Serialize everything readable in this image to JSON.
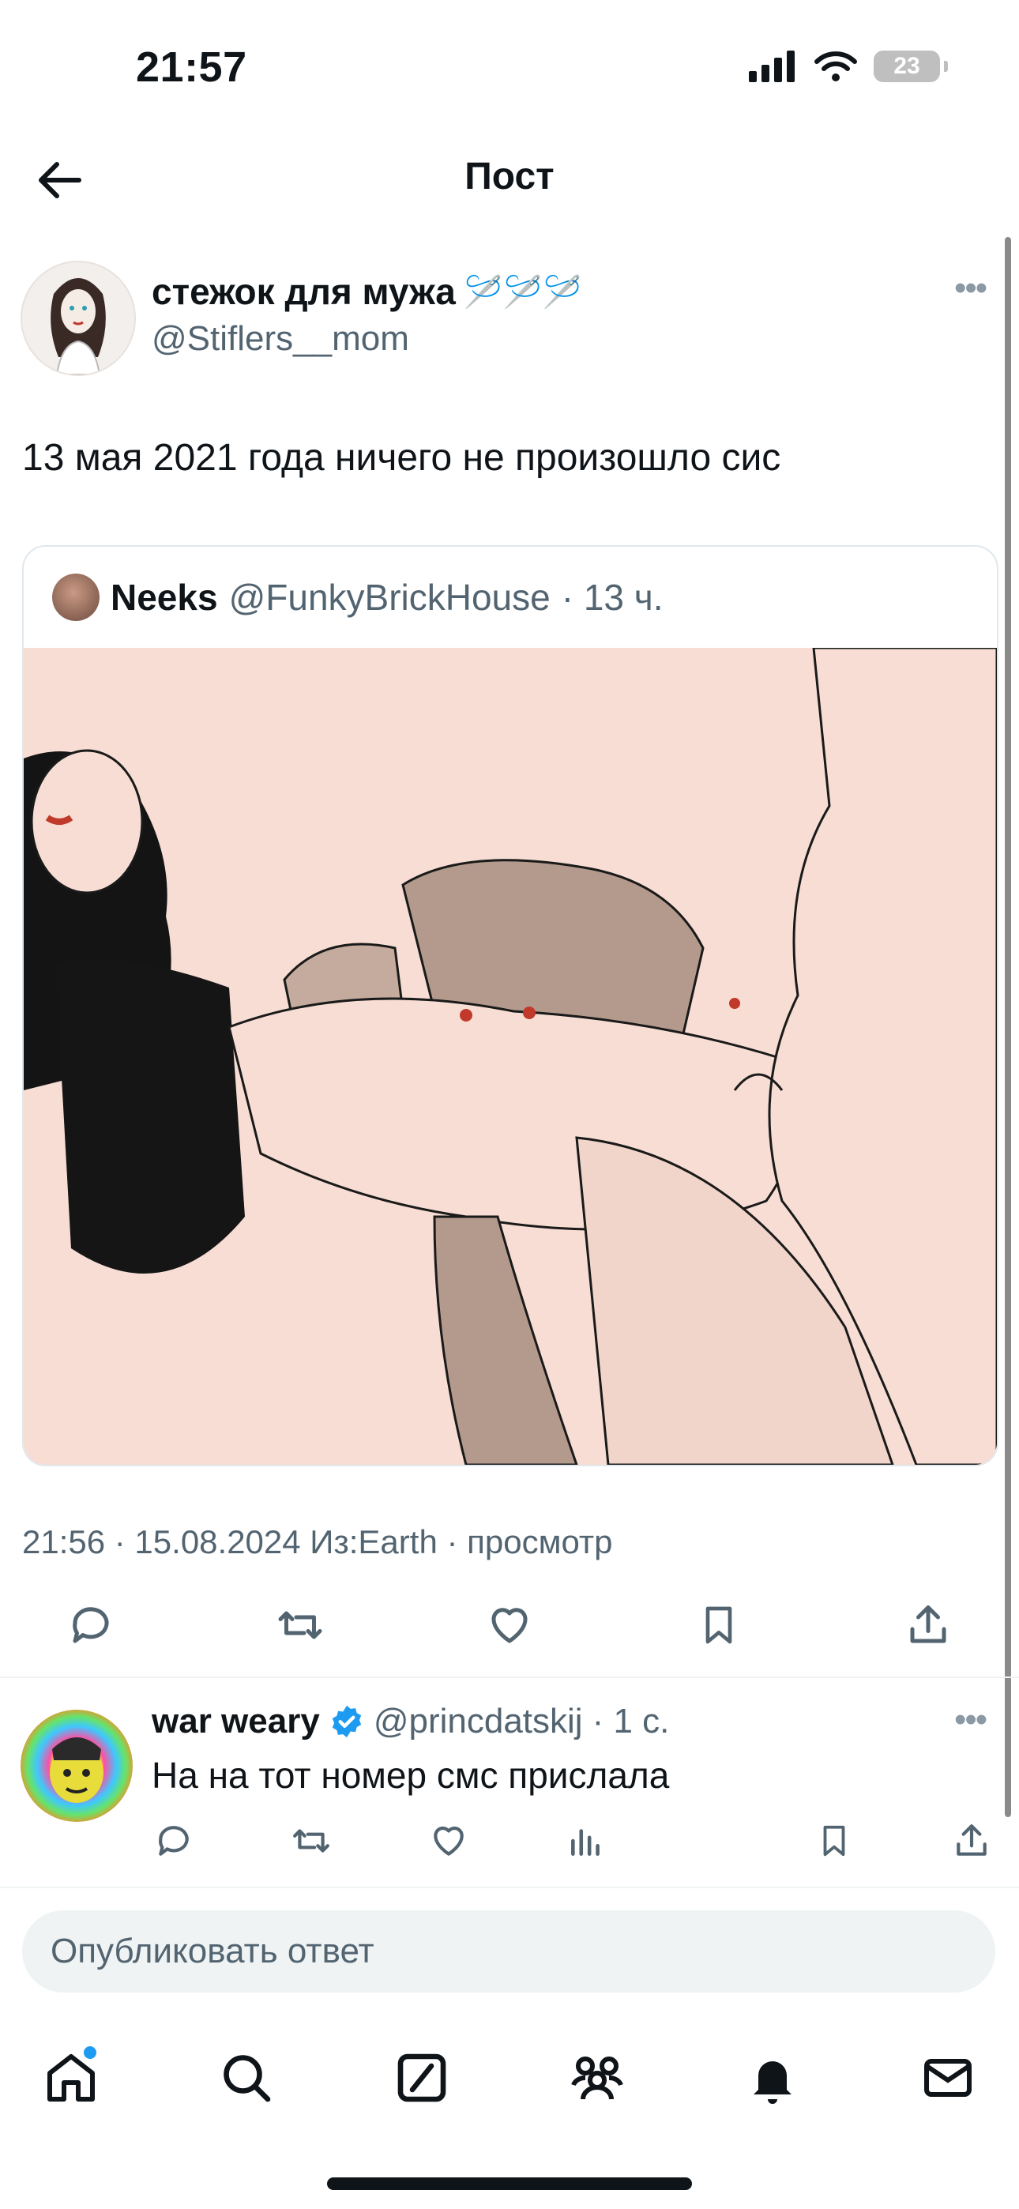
{
  "status_bar": {
    "time": "21:57",
    "battery": "23"
  },
  "header": {
    "title": "Пост"
  },
  "post": {
    "author_name": "стежок для мужа",
    "author_emoji": "🪡🪡🪡",
    "author_handle": "@Stiflers__mom",
    "text": "13 мая 2021 года ничего не произошло сис",
    "meta": "21:56 · 15.08.2024 Из:Earth · просмотр",
    "quote": {
      "name": "Neeks",
      "handle": "@FunkyBrickHouse",
      "time": "· 13 ч."
    }
  },
  "reply": {
    "name": "war weary",
    "handle": "@princdatskij",
    "time": "· 1 с.",
    "text": "На на тот номер смс прислала"
  },
  "composer": {
    "placeholder": "Опубликовать ответ"
  },
  "icons": {
    "back": "arrow-left-icon",
    "more": "more-horizontal-icon",
    "reply": "reply-icon",
    "repost": "repost-icon",
    "like": "heart-icon",
    "bookmark": "bookmark-icon",
    "share": "share-icon",
    "views": "views-icon",
    "verified": "verified-badge-icon",
    "tabs": [
      "home-icon",
      "search-icon",
      "grok-icon",
      "communities-icon",
      "notifications-icon",
      "messages-icon"
    ]
  },
  "colors": {
    "accent": "#1d9bf0",
    "secondary_text": "#536471",
    "illustration_bg": "#f7ddd3"
  }
}
